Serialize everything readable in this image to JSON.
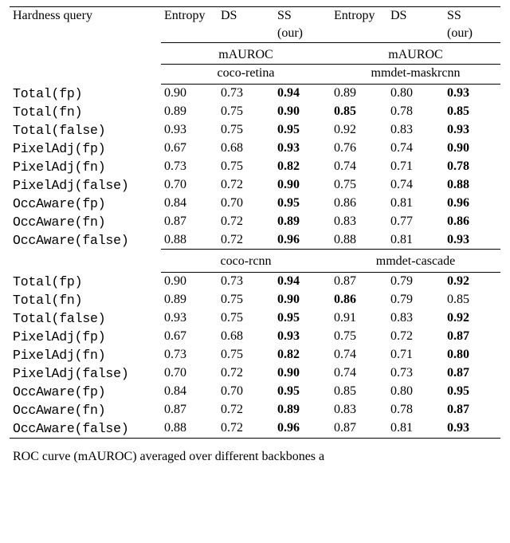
{
  "header": {
    "hardness_query": "Hardness query",
    "entropy": "Entropy",
    "ds": "DS",
    "ss": "SS",
    "our": "(our)",
    "mauroc": "mAUROC"
  },
  "row_labels": [
    "Total(fp)",
    "Total(fn)",
    "Total(false)",
    "PixelAdj(fp)",
    "PixelAdj(fn)",
    "PixelAdj(false)",
    "OccAware(fp)",
    "OccAware(fn)",
    "OccAware(false)"
  ],
  "blocks": [
    {
      "groups": [
        {
          "name": "coco-retina",
          "rows": [
            {
              "entropy": "0.90",
              "ds": "0.73",
              "ss": "0.94",
              "bold": [
                "ss"
              ]
            },
            {
              "entropy": "0.89",
              "ds": "0.75",
              "ss": "0.90",
              "bold": [
                "ss"
              ]
            },
            {
              "entropy": "0.93",
              "ds": "0.75",
              "ss": "0.95",
              "bold": [
                "ss"
              ]
            },
            {
              "entropy": "0.67",
              "ds": "0.68",
              "ss": "0.93",
              "bold": [
                "ss"
              ]
            },
            {
              "entropy": "0.73",
              "ds": "0.75",
              "ss": "0.82",
              "bold": [
                "ss"
              ]
            },
            {
              "entropy": "0.70",
              "ds": "0.72",
              "ss": "0.90",
              "bold": [
                "ss"
              ]
            },
            {
              "entropy": "0.84",
              "ds": "0.70",
              "ss": "0.95",
              "bold": [
                "ss"
              ]
            },
            {
              "entropy": "0.87",
              "ds": "0.72",
              "ss": "0.89",
              "bold": [
                "ss"
              ]
            },
            {
              "entropy": "0.88",
              "ds": "0.72",
              "ss": "0.96",
              "bold": [
                "ss"
              ]
            }
          ]
        },
        {
          "name": "mmdet-maskrcnn",
          "rows": [
            {
              "entropy": "0.89",
              "ds": "0.80",
              "ss": "0.93",
              "bold": [
                "ss"
              ]
            },
            {
              "entropy": "0.85",
              "ds": "0.78",
              "ss": "0.85",
              "bold": [
                "entropy",
                "ss"
              ]
            },
            {
              "entropy": "0.92",
              "ds": "0.83",
              "ss": "0.93",
              "bold": [
                "ss"
              ]
            },
            {
              "entropy": "0.76",
              "ds": "0.74",
              "ss": "0.90",
              "bold": [
                "ss"
              ]
            },
            {
              "entropy": "0.74",
              "ds": "0.71",
              "ss": "0.78",
              "bold": [
                "ss"
              ]
            },
            {
              "entropy": "0.75",
              "ds": "0.74",
              "ss": "0.88",
              "bold": [
                "ss"
              ]
            },
            {
              "entropy": "0.86",
              "ds": "0.81",
              "ss": "0.96",
              "bold": [
                "ss"
              ]
            },
            {
              "entropy": "0.83",
              "ds": "0.77",
              "ss": "0.86",
              "bold": [
                "ss"
              ]
            },
            {
              "entropy": "0.88",
              "ds": "0.81",
              "ss": "0.93",
              "bold": [
                "ss"
              ]
            }
          ]
        }
      ]
    },
    {
      "groups": [
        {
          "name": "coco-rcnn",
          "rows": [
            {
              "entropy": "0.90",
              "ds": "0.73",
              "ss": "0.94",
              "bold": [
                "ss"
              ]
            },
            {
              "entropy": "0.89",
              "ds": "0.75",
              "ss": "0.90",
              "bold": [
                "ss"
              ]
            },
            {
              "entropy": "0.93",
              "ds": "0.75",
              "ss": "0.95",
              "bold": [
                "ss"
              ]
            },
            {
              "entropy": "0.67",
              "ds": "0.68",
              "ss": "0.93",
              "bold": [
                "ss"
              ]
            },
            {
              "entropy": "0.73",
              "ds": "0.75",
              "ss": "0.82",
              "bold": [
                "ss"
              ]
            },
            {
              "entropy": "0.70",
              "ds": "0.72",
              "ss": "0.90",
              "bold": [
                "ss"
              ]
            },
            {
              "entropy": "0.84",
              "ds": "0.70",
              "ss": "0.95",
              "bold": [
                "ss"
              ]
            },
            {
              "entropy": "0.87",
              "ds": "0.72",
              "ss": "0.89",
              "bold": [
                "ss"
              ]
            },
            {
              "entropy": "0.88",
              "ds": "0.72",
              "ss": "0.96",
              "bold": [
                "ss"
              ]
            }
          ]
        },
        {
          "name": "mmdet-cascade",
          "rows": [
            {
              "entropy": "0.87",
              "ds": "0.79",
              "ss": "0.92",
              "bold": [
                "ss"
              ]
            },
            {
              "entropy": "0.86",
              "ds": "0.79",
              "ss": "0.85",
              "bold": [
                "entropy"
              ]
            },
            {
              "entropy": "0.91",
              "ds": "0.83",
              "ss": "0.92",
              "bold": [
                "ss"
              ]
            },
            {
              "entropy": "0.75",
              "ds": "0.72",
              "ss": "0.87",
              "bold": [
                "ss"
              ]
            },
            {
              "entropy": "0.74",
              "ds": "0.71",
              "ss": "0.80",
              "bold": [
                "ss"
              ]
            },
            {
              "entropy": "0.74",
              "ds": "0.73",
              "ss": "0.87",
              "bold": [
                "ss"
              ]
            },
            {
              "entropy": "0.85",
              "ds": "0.80",
              "ss": "0.95",
              "bold": [
                "ss"
              ]
            },
            {
              "entropy": "0.83",
              "ds": "0.78",
              "ss": "0.87",
              "bold": [
                "ss"
              ]
            },
            {
              "entropy": "0.87",
              "ds": "0.81",
              "ss": "0.93",
              "bold": [
                "ss"
              ]
            }
          ]
        }
      ]
    }
  ],
  "caption_fragment": "ROC curve (mAUROC) averaged over different backbones a"
}
